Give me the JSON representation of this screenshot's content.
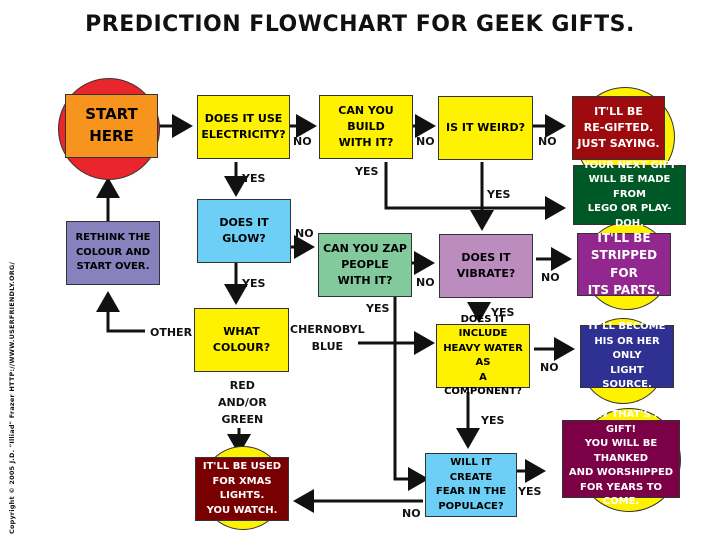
{
  "title": "Prediction Flowchart for Geek Gifts.",
  "copyright": "Copyright © 2005 J.D. \"Illiad\" Frazer  HTTP://WWW.USERFRIENDLY.ORG/",
  "colors": {
    "start": "#f7941d",
    "start_circle": "#e8262c",
    "question_yellow": "#fff200",
    "question_blue": "#6dcff6",
    "question_green": "#82ca9c",
    "question_lilac": "#bd8cbf",
    "rethink": "#8781bd",
    "outcome_red": "#9e0b0f",
    "outcome_green": "#005826",
    "outcome_purple": "#92278f",
    "outcome_navy": "#2e3192",
    "outcome_maroon": "#790000",
    "outcome_wine": "#7b0046",
    "outcome_circle": "#fff200"
  },
  "nodes": {
    "start": {
      "lines": [
        "Start",
        "Here"
      ]
    },
    "electricity": {
      "lines": [
        "Does it use",
        "electricity?"
      ]
    },
    "build": {
      "lines": [
        "Can you build",
        "with it?"
      ]
    },
    "weird": {
      "lines": [
        "Is it weird?"
      ]
    },
    "regifted": {
      "lines": [
        "It'll be",
        "re-gifted.",
        "Just saying."
      ]
    },
    "lego": {
      "lines": [
        "Your next gift",
        "will be made from",
        "Lego or Play-Doh."
      ]
    },
    "glow": {
      "lines": [
        "Does it",
        "glow?"
      ]
    },
    "zap": {
      "lines": [
        "Can you zap",
        "people",
        "with it?"
      ]
    },
    "vibrate": {
      "lines": [
        "Does it",
        "vibrate?"
      ]
    },
    "stripped": {
      "lines": [
        "It'll be",
        "stripped for",
        "its parts."
      ]
    },
    "rethink": {
      "lines": [
        "Rethink the",
        "colour and",
        "start over."
      ]
    },
    "colour": {
      "lines": [
        "What",
        "colour?"
      ]
    },
    "heavywater": {
      "lines": [
        "Does it include",
        "heavy water as",
        "a component?"
      ]
    },
    "lightsource": {
      "lines": [
        "It'll become",
        "his or her only",
        "light source."
      ]
    },
    "xmas": {
      "lines": [
        "It'll be used",
        "for Xmas lights.",
        "You watch."
      ]
    },
    "fear": {
      "lines": [
        "Will it create",
        "fear in the",
        "populace?"
      ]
    },
    "gift": {
      "lines": [
        "Now that's a gift!",
        "You will be thanked",
        "and worshipped",
        "for years to come."
      ]
    }
  },
  "labels": {
    "elec_no": "No",
    "build_no": "No",
    "weird_no": "No",
    "elec_yes": "Yes",
    "build_yes": "Yes",
    "weird_yes": "Yes",
    "glow_no": "No",
    "glow_yes": "Yes",
    "zap_no": "No",
    "zap_yes": "Yes",
    "vibrate_no": "No",
    "vibrate_yes": "Yes",
    "other": "Other",
    "chernobyl": [
      "Chernobyl",
      "blue"
    ],
    "redgreen": [
      "Red",
      "and/or",
      "green"
    ],
    "heavy_no": "No",
    "heavy_yes": "Yes",
    "fear_yes": "Yes",
    "fear_no": "No"
  }
}
